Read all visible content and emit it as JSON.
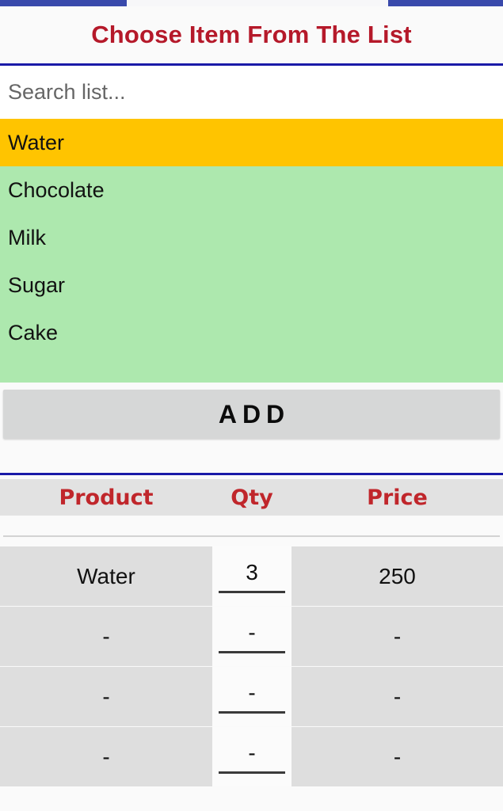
{
  "header": {
    "title": "Choose Item From The List",
    "title_color": "#b5192a",
    "divider_color": "#1a1aa8"
  },
  "search": {
    "placeholder": "Search list...",
    "value": ""
  },
  "list": {
    "selected_color": "#ffc400",
    "background_color": "#ade8ae",
    "items": [
      {
        "label": "Water",
        "selected": true
      },
      {
        "label": "Chocolate",
        "selected": false
      },
      {
        "label": "Milk",
        "selected": false
      },
      {
        "label": "Sugar",
        "selected": false
      },
      {
        "label": "Cake",
        "selected": false
      }
    ]
  },
  "actions": {
    "add_label": "ADD"
  },
  "table": {
    "columns": [
      "Product",
      "Qty",
      "Price"
    ],
    "header_color": "#c0262b",
    "rows": [
      {
        "product": "Water",
        "qty": "3",
        "price": "250"
      },
      {
        "product": "-",
        "qty": "-",
        "price": "-"
      },
      {
        "product": "-",
        "qty": "-",
        "price": "-"
      },
      {
        "product": "-",
        "qty": "-",
        "price": "-"
      }
    ]
  }
}
